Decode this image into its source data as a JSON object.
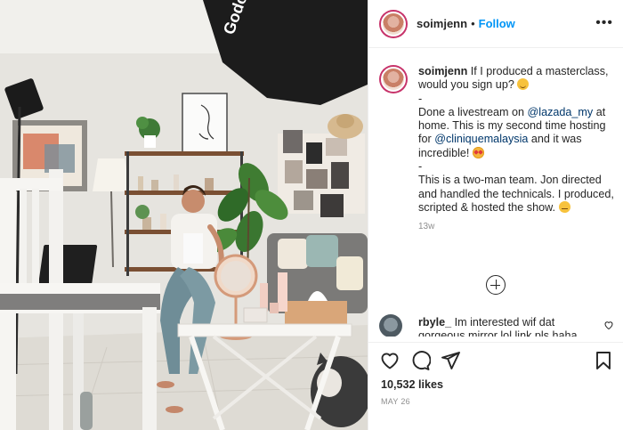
{
  "post": {
    "username": "soimjenn",
    "follow_label": "Follow",
    "header_separator": "•",
    "more_label": "•••",
    "caption": {
      "username": "soimjenn",
      "line1": "If I produced a masterclass, would you sign up?",
      "line2_prefix": "-\nDone a livestream on ",
      "mention_lazada": "@lazada_my",
      "line2_mid": " at home. This is my second time hosting for ",
      "mention_clinique": "@cliniquemalaysia",
      "line2_suffix": " and it was incredible!",
      "line3": "-\nThis is a two-man team. Jon directed and handled the technicals. I produced, scripted & hosted the show.",
      "time": "13w",
      "emoji_names": [
        "smiling-face-icon",
        "star-struck-face-icon",
        "thinking-face-icon"
      ]
    },
    "comment": {
      "username": "rbyle_",
      "text": "Im interested wif dat gorgeous mirror lol link pls haha"
    },
    "likes": "10,532 likes",
    "date": "MAY 26",
    "colors": {
      "follow": "#0095f6",
      "mention": "#00376b",
      "avatar_ring": "#c7336a",
      "muted": "#8e8e8e"
    },
    "photo_text": {
      "softbox_brand": "Godox"
    }
  }
}
